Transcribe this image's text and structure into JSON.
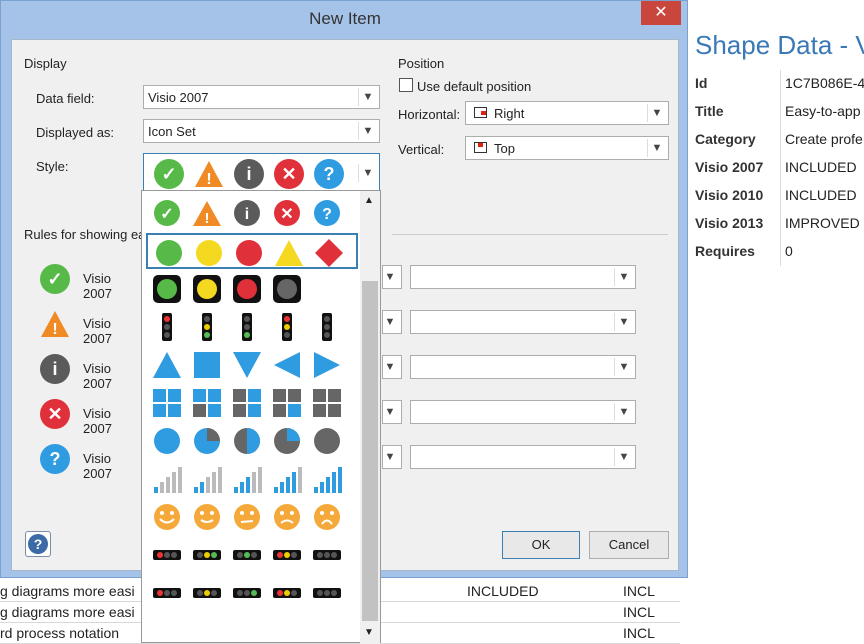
{
  "dialog": {
    "title": "New Item",
    "display_section": "Display",
    "data_field_label": "Data field:",
    "data_field_value": "Visio 2007",
    "displayed_as_label": "Displayed as:",
    "displayed_as_value": "Icon Set",
    "style_label": "Style:",
    "position_section": "Position",
    "use_default_position_label": "Use default position",
    "horizontal_label": "Horizontal:",
    "horizontal_value": "Right",
    "vertical_label": "Vertical:",
    "vertical_value": "Top",
    "rules_label": "Rules for showing ea",
    "ok_label": "OK",
    "cancel_label": "Cancel",
    "rules": [
      {
        "icon": "check-icon",
        "color": "#57b947",
        "label": "Visio 2007"
      },
      {
        "icon": "warning-icon",
        "color": "#f08a24",
        "label": "Visio 2007"
      },
      {
        "icon": "info-icon",
        "color": "#5b5b5b",
        "label": "Visio 2007"
      },
      {
        "icon": "error-icon",
        "color": "#e0303a",
        "label": "Visio 2007"
      },
      {
        "icon": "question-icon",
        "color": "#2f9be0",
        "label": "Visio 2007"
      }
    ]
  },
  "shape_data": {
    "title": "Shape Data - V",
    "rows": [
      {
        "key": "Id",
        "value": "1C7B086E-4"
      },
      {
        "key": "Title",
        "value": "Easy-to-app"
      },
      {
        "key": "Category",
        "value": "Create profe"
      },
      {
        "key": "Visio 2007",
        "value": "INCLUDED"
      },
      {
        "key": "Visio 2010",
        "value": "INCLUDED"
      },
      {
        "key": "Visio 2013",
        "value": "IMPROVED"
      },
      {
        "key": "Requires",
        "value": "0"
      }
    ]
  },
  "background_rows": [
    {
      "left": "g diagrams more easi",
      "mid": "INCLUDED",
      "right": "INCL"
    },
    {
      "left": "g diagrams more easi",
      "mid": "",
      "right": "INCL"
    },
    {
      "left": "rd process notation",
      "mid": "",
      "right": "INCL"
    }
  ],
  "colors": {
    "accent": "#3c7fb1",
    "green": "#57b947",
    "orange": "#f08a24",
    "gray": "#5b5b5b",
    "red": "#e0303a",
    "blue": "#2f9be0",
    "yellow": "#f5d820"
  }
}
